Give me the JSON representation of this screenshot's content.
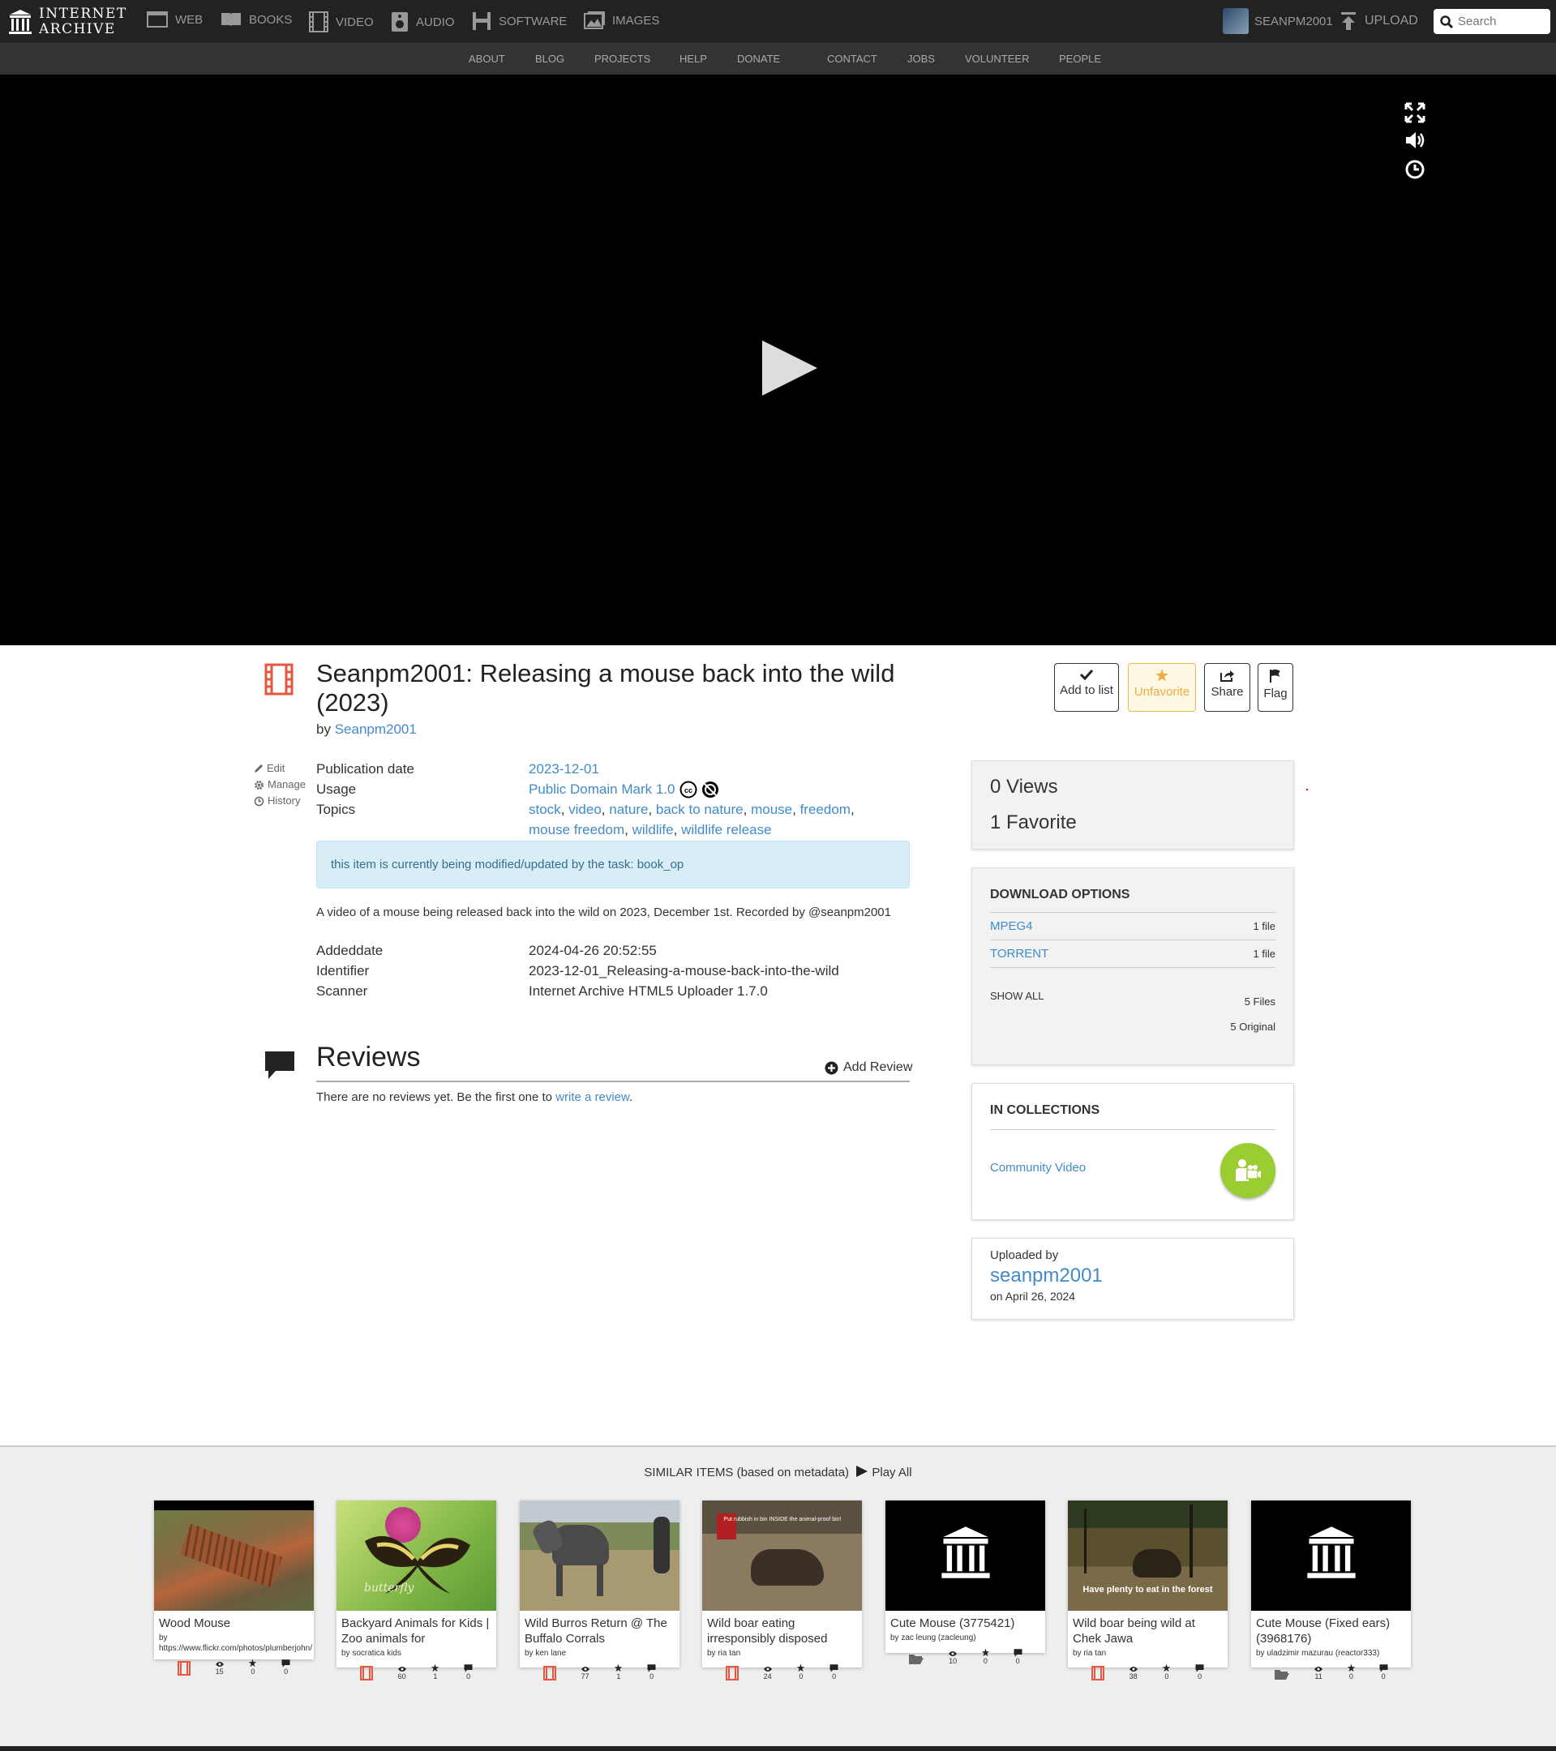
{
  "topnav": {
    "logo_line1": "INTERNET",
    "logo_line2": "ARCHIVE",
    "media": [
      {
        "label": "WEB",
        "icon": "web-icon"
      },
      {
        "label": "BOOKS",
        "icon": "books-icon"
      },
      {
        "label": "VIDEO",
        "icon": "video-icon"
      },
      {
        "label": "AUDIO",
        "icon": "audio-icon"
      },
      {
        "label": "SOFTWARE",
        "icon": "software-icon"
      },
      {
        "label": "IMAGES",
        "icon": "images-icon"
      }
    ],
    "username": "SEANPM2001",
    "upload": "UPLOAD",
    "search_placeholder": "Search"
  },
  "subnav": [
    "ABOUT",
    "BLOG",
    "PROJECTS",
    "HELP",
    "DONATE",
    "CONTACT",
    "JOBS",
    "VOLUNTEER",
    "PEOPLE"
  ],
  "item": {
    "title": "Seanpm2001: Releasing a mouse back into the wild (2023)",
    "by_prefix": "by",
    "creator": "Seanpm2001",
    "actions": {
      "add_to_list": "Add to list",
      "unfavorite": "Unfavorite",
      "share": "Share",
      "flag": "Flag"
    },
    "sidelinks": {
      "edit": "Edit",
      "manage": "Manage",
      "history": "History"
    },
    "metadata": {
      "pubdate_label": "Publication date",
      "pubdate": "2023-12-01",
      "usage_label": "Usage",
      "usage": "Public Domain Mark 1.0",
      "topics_label": "Topics",
      "topics": [
        "stock",
        "video",
        "nature",
        "back to nature",
        "mouse",
        "freedom",
        "mouse freedom",
        "wildlife",
        "wildlife release"
      ]
    },
    "alert": "this item is currently being modified/updated by the task: book_op",
    "description": "A video of a mouse being released back into the wild on 2023, December 1st. Recorded by @seanpm2001",
    "extra": {
      "addeddate_label": "Addeddate",
      "addeddate": "2024-04-26 20:52:55",
      "identifier_label": "Identifier",
      "identifier": "2023-12-01_Releasing-a-mouse-back-into-the-wild",
      "scanner_label": "Scanner",
      "scanner": "Internet Archive HTML5 Uploader 1.7.0"
    }
  },
  "reviews": {
    "heading": "Reviews",
    "add": "Add Review",
    "none_prefix": "There are no reviews yet. Be the first one to",
    "write_link": "write a review",
    "none_suffix": "."
  },
  "stats": {
    "views": "0 Views",
    "favorites": "1 Favorite"
  },
  "downloads": {
    "heading": "DOWNLOAD OPTIONS",
    "rows": [
      {
        "label": "MPEG4",
        "count": "1 file"
      },
      {
        "label": "TORRENT",
        "count": "1 file"
      }
    ],
    "show_all": "SHOW ALL",
    "files": "5 Files",
    "original": "5 Original"
  },
  "collections": {
    "heading": "IN COLLECTIONS",
    "name": "Community Video",
    "accent": "#9acd32"
  },
  "uploader": {
    "label": "Uploaded by",
    "name": "seanpm2001",
    "date": "on April 26, 2024"
  },
  "similar": {
    "heading": "SIMILAR ITEMS (based on metadata)",
    "play_all": "Play All",
    "items": [
      {
        "title": "Wood Mouse",
        "by": "by https://www.flickr.com/photos/plumberjohn/",
        "type": "film-icon",
        "views": "15",
        "favs": "0",
        "reviews": "0",
        "overlay": ""
      },
      {
        "title": "Backyard Animals for Kids | Zoo animals for",
        "by": "by socratica kids",
        "type": "film-icon",
        "views": "60",
        "favs": "1",
        "reviews": "0",
        "overlay": "butterfly"
      },
      {
        "title": "Wild Burros Return @ The Buffalo Corrals",
        "by": "by ken lane",
        "type": "film-icon",
        "views": "77",
        "favs": "1",
        "reviews": "0",
        "overlay": ""
      },
      {
        "title": "Wild boar eating irresponsibly disposed",
        "by": "by ria tan",
        "type": "film-icon",
        "views": "24",
        "favs": "0",
        "reviews": "0",
        "overlay": "Put rubbish in bin INSIDE the animal-proof bin!"
      },
      {
        "title": "Cute Mouse (3775421)",
        "by": "by zac leung (zacleung)",
        "type": "folder-icon",
        "views": "10",
        "favs": "0",
        "reviews": "0",
        "overlay": ""
      },
      {
        "title": "Wild boar being wild at Chek Jawa",
        "by": "by ria tan",
        "type": "film-icon",
        "views": "38",
        "favs": "0",
        "reviews": "0",
        "overlay": "Have plenty to eat in the forest"
      },
      {
        "title": "Cute Mouse (Fixed ears) (3968176)",
        "by": "by uladzimir mazurau (reactor333)",
        "type": "folder-icon",
        "views": "11",
        "favs": "0",
        "reviews": "0",
        "overlay": ""
      }
    ]
  }
}
